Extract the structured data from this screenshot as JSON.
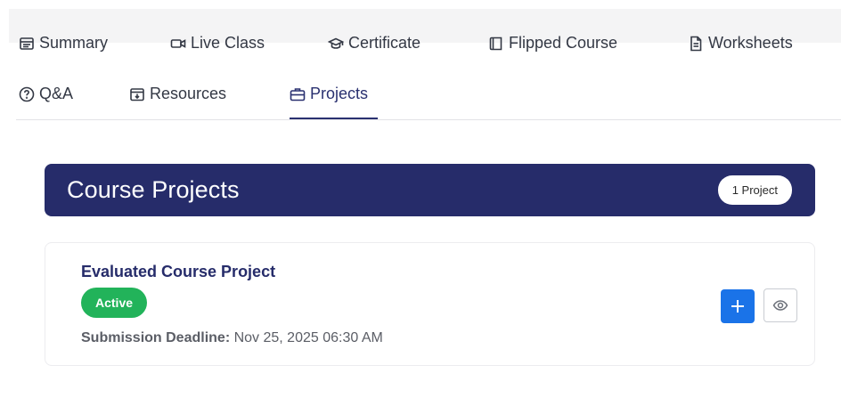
{
  "tabs": [
    {
      "label": "Summary",
      "icon": "summary-icon"
    },
    {
      "label": "Live Class",
      "icon": "video-icon"
    },
    {
      "label": "Certificate",
      "icon": "graduation-cap-icon"
    },
    {
      "label": "Flipped Course",
      "icon": "book-icon"
    },
    {
      "label": "Worksheets",
      "icon": "document-icon"
    },
    {
      "label": "Q&A",
      "icon": "question-icon"
    },
    {
      "label": "Resources",
      "icon": "download-box-icon"
    },
    {
      "label": "Projects",
      "icon": "briefcase-icon",
      "active": true
    }
  ],
  "banner": {
    "title": "Course Projects",
    "count": "1 Project"
  },
  "project": {
    "title": "Evaluated Course Project",
    "status": "Active",
    "deadline_label": "Submission Deadline:",
    "deadline_value": "Nov 25, 2025 06:30 AM"
  },
  "colors": {
    "banner": "#262c6a",
    "active_badge": "#22b35a",
    "add_button": "#1a73e8"
  }
}
